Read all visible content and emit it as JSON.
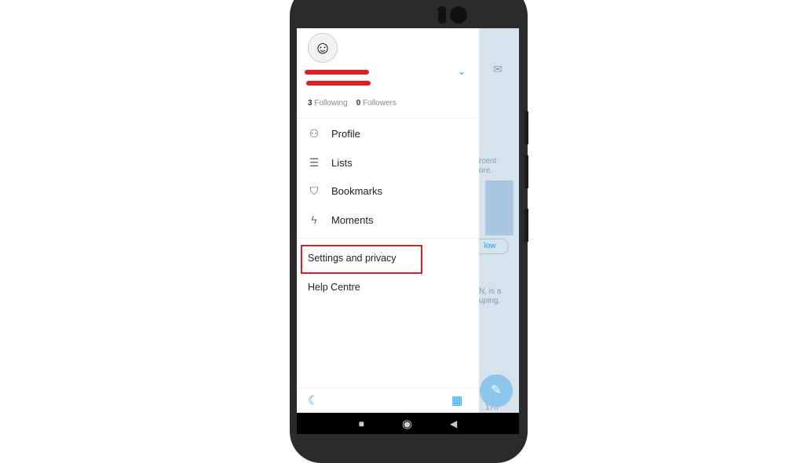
{
  "drawer": {
    "following_count": "3",
    "following_label": "Following",
    "followers_count": "0",
    "followers_label": "Followers",
    "menu": [
      {
        "label": "Profile",
        "icon": "person-icon"
      },
      {
        "label": "Lists",
        "icon": "list-icon"
      },
      {
        "label": "Bookmarks",
        "icon": "bookmark-icon"
      },
      {
        "label": "Moments",
        "icon": "lightning-icon"
      }
    ],
    "settings_label": "Settings and privacy",
    "help_label": "Help Centre"
  },
  "background": {
    "text1a": "rcent",
    "text1b": "ore.",
    "follow_button": "low",
    "text2a": "N, is a",
    "text2b": "uping.",
    "time": "17h"
  },
  "colors": {
    "accent": "#1da1f2",
    "highlight": "#e31b23"
  }
}
